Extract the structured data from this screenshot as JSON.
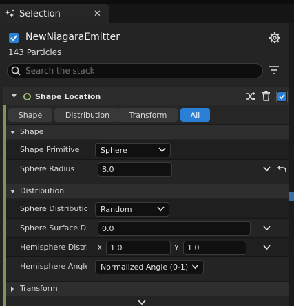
{
  "tab": {
    "title": "Selection",
    "close": "✕",
    "icon": "sparkle-icon"
  },
  "emitter": {
    "name": "NewNiagaraEmitter",
    "particles": "143 Particles",
    "enabled": true
  },
  "search": {
    "placeholder": "Search the stack",
    "value": ""
  },
  "module": {
    "title": "Shape Location",
    "enabled": true
  },
  "filter_tabs": [
    {
      "label": "Shape",
      "active": false
    },
    {
      "label": "Distribution",
      "active": false
    },
    {
      "label": "Transform",
      "active": false
    },
    {
      "label": "All",
      "active": true
    }
  ],
  "categories": {
    "shape": "Shape",
    "distribution": "Distribution",
    "transform": "Transform"
  },
  "params": {
    "shape_primitive": {
      "label": "Shape Primitive",
      "value": "Sphere"
    },
    "sphere_radius": {
      "label": "Sphere Radius",
      "value": "8.0"
    },
    "sphere_distribution": {
      "label": "Sphere Distribution",
      "value": "Random"
    },
    "sphere_surface": {
      "label": "Sphere Surface Dis",
      "value": "0.0"
    },
    "hemisphere_distrib": {
      "label": "Hemisphere Distrib",
      "x_label": "X",
      "x_value": "1.0",
      "y_label": "Y",
      "y_value": "1.0"
    },
    "hemisphere_angle": {
      "label": "Hemisphere Angle",
      "value": "Normalized Angle (0-1)"
    }
  },
  "colors": {
    "accent": "#2a7fd4",
    "module_bar": "#7d9556"
  }
}
